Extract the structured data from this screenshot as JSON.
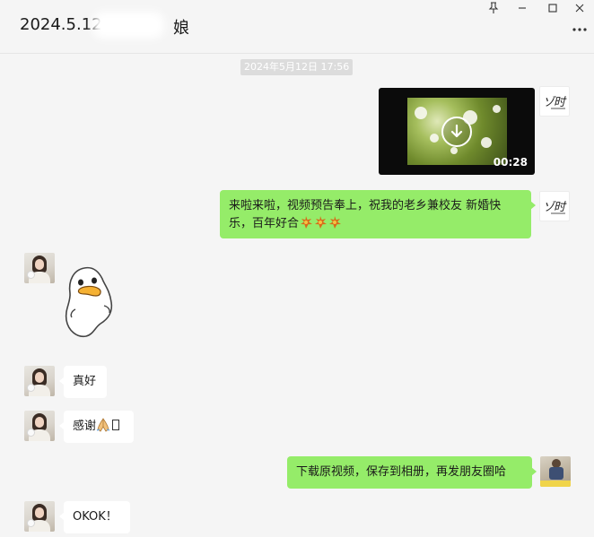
{
  "window": {
    "title": "2024.5.12",
    "title_tail": "娘",
    "pin_icon": "pin-icon",
    "minimize_icon": "minimize-icon",
    "maximize_icon": "maximize-icon",
    "close_icon": "close-icon",
    "more_icon": "more-icon"
  },
  "chat": {
    "timestamp": "2024年5月12日 17:56",
    "video": {
      "duration": "00:28",
      "icon": "download-icon"
    },
    "messages": [
      {
        "sender": "me",
        "text": "来啦来啦，视频预告奉上，祝我的老乡兼校友 新婚快",
        "text_line2": "乐，百年好合",
        "emoji": "firework-icon"
      },
      {
        "sender": "other",
        "type": "sticker",
        "sticker": "duck-sticker"
      },
      {
        "sender": "other",
        "text": "真好"
      },
      {
        "sender": "other",
        "text": "感谢",
        "emoji": "pray-icon"
      },
      {
        "sender": "me",
        "text": "下载原视频，保存到相册，再发朋友圈哈"
      },
      {
        "sender": "other",
        "text": "OKOK！"
      }
    ]
  },
  "colors": {
    "my_bubble": "#95ec69",
    "their_bubble": "#ffffff",
    "background": "#f5f5f5"
  }
}
